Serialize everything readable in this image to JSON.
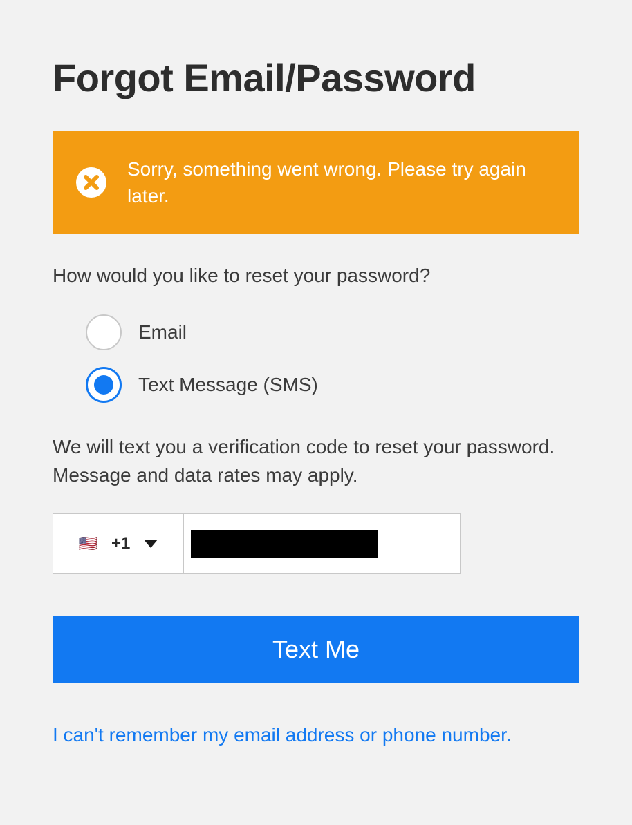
{
  "title": "Forgot Email/Password",
  "alert": {
    "message": "Sorry, something went wrong. Please try again later."
  },
  "prompt": "How would you like to reset your password?",
  "options": {
    "email": {
      "label": "Email",
      "selected": false
    },
    "sms": {
      "label": "Text Message (SMS)",
      "selected": true
    }
  },
  "info": "We will text you a verification code to reset your password. Message and data rates may apply.",
  "phone": {
    "dial_code": "+1",
    "flag": "🇺🇸"
  },
  "submit_label": "Text Me",
  "help_link": "I can't remember my email address or phone number."
}
